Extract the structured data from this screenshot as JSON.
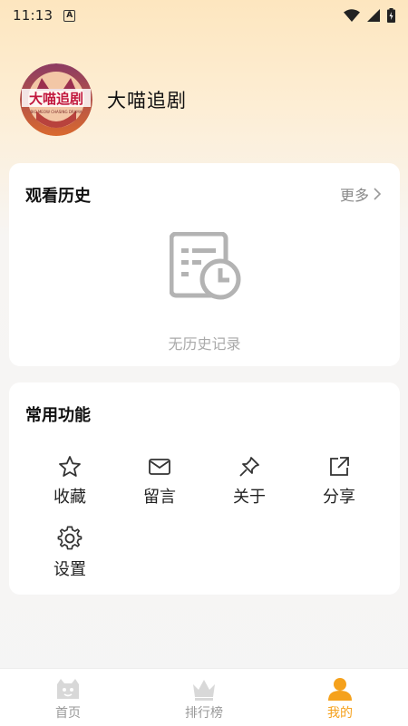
{
  "status_bar": {
    "time": "11:13",
    "notif_icon": "A"
  },
  "profile": {
    "name": "大喵追剧",
    "logo_text": "大喵追剧",
    "logo_subtext": "BIG MEOW CHASING DRAMA"
  },
  "history": {
    "title": "观看历史",
    "more_label": "更多",
    "empty_text": "无历史记录"
  },
  "functions": {
    "title": "常用功能",
    "items": [
      {
        "label": "收藏",
        "icon": "star-icon"
      },
      {
        "label": "留言",
        "icon": "mail-icon"
      },
      {
        "label": "关于",
        "icon": "pin-icon"
      },
      {
        "label": "分享",
        "icon": "share-icon"
      },
      {
        "label": "设置",
        "icon": "gear-icon"
      }
    ]
  },
  "bottom_nav": {
    "items": [
      {
        "label": "首页",
        "icon": "home-cat-icon",
        "active": false
      },
      {
        "label": "排行榜",
        "icon": "crown-icon",
        "active": false
      },
      {
        "label": "我的",
        "icon": "user-icon",
        "active": true
      }
    ]
  },
  "colors": {
    "accent": "#f5a11c",
    "inactive": "#999999",
    "card": "#ffffff"
  }
}
